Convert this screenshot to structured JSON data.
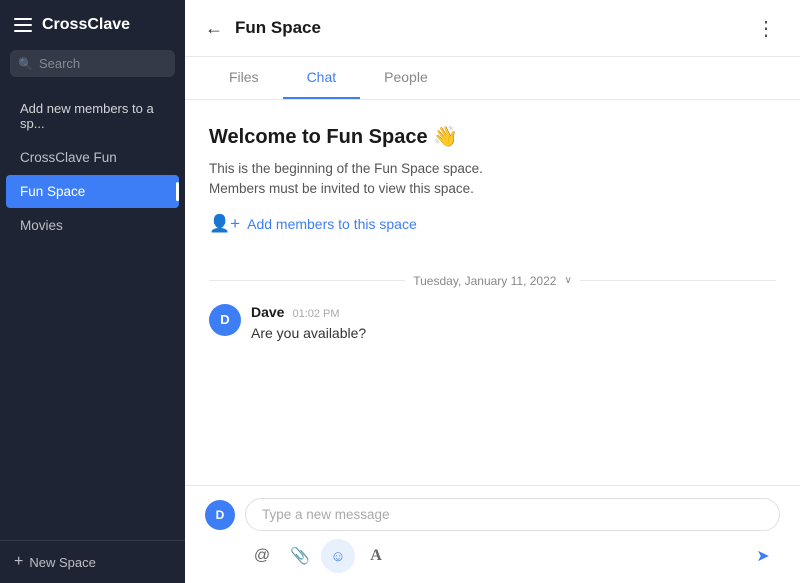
{
  "app": {
    "name": "CrossClave"
  },
  "sidebar": {
    "search_placeholder": "Search",
    "items": [
      {
        "id": "add-members",
        "label": "Add new members to a sp...",
        "active": false,
        "special": true
      },
      {
        "id": "crossclave-fun",
        "label": "CrossClave Fun",
        "active": false
      },
      {
        "id": "fun-space",
        "label": "Fun Space",
        "active": true
      },
      {
        "id": "movies",
        "label": "Movies",
        "active": false
      }
    ],
    "new_space_label": "+ New Space"
  },
  "header": {
    "back_label": "←",
    "title": "Fun Space",
    "more_icon": "⋮"
  },
  "tabs": [
    {
      "id": "files",
      "label": "Files",
      "active": false
    },
    {
      "id": "chat",
      "label": "Chat",
      "active": true
    },
    {
      "id": "people",
      "label": "People",
      "active": false
    }
  ],
  "welcome": {
    "title": "Welcome to Fun Space 👋",
    "description_line1": "This is the beginning of the Fun Space space.",
    "description_line2": "Members must be invited to view this space.",
    "add_members_label": "Add members to this space"
  },
  "date_divider": {
    "label": "Tuesday, January 11, 2022",
    "collapse_icon": "∨"
  },
  "messages": [
    {
      "id": "msg1",
      "author": "Dave",
      "time": "01:02 PM",
      "avatar_letter": "D",
      "text": "Are you available?"
    }
  ],
  "input": {
    "placeholder": "Type a new message",
    "user_avatar_letter": "D"
  },
  "toolbar": {
    "mention_icon": "@",
    "attach_icon": "📎",
    "emoji_icon": "☺",
    "format_icon": "A",
    "send_icon": "➤"
  }
}
